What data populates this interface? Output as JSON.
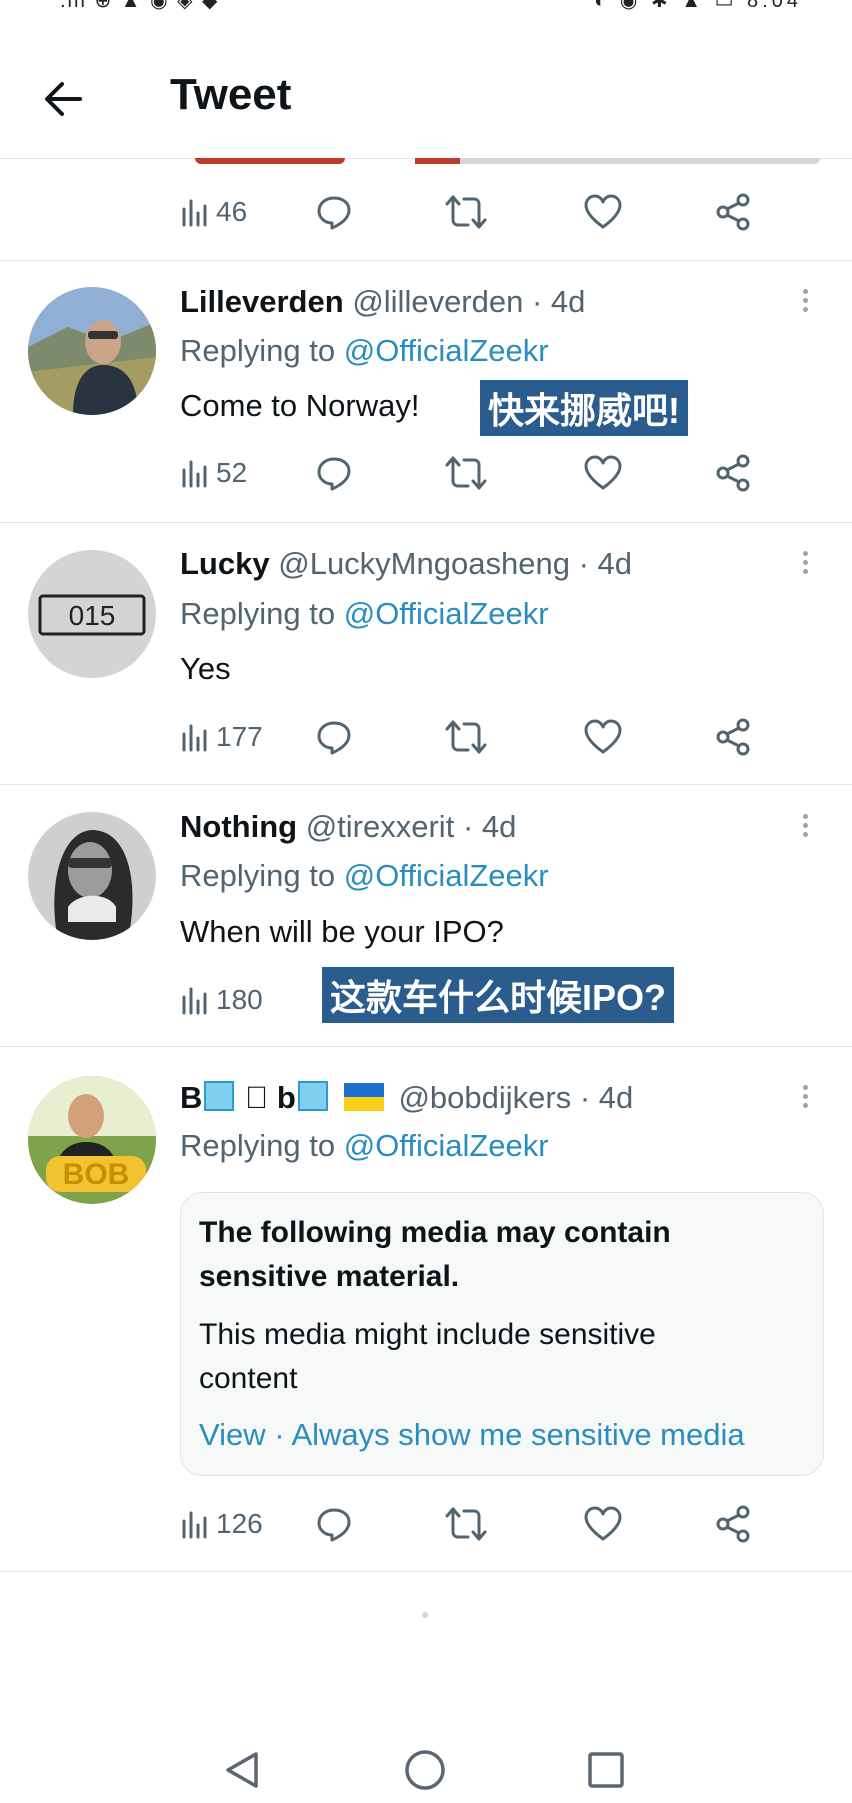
{
  "status_bar": {
    "left_text": ".ill ⊕ ▲ ◉ ◈ ◆",
    "right_text": "◐ ◉ ✱ ▲ ▭ 8:04"
  },
  "header": {
    "title": "Tweet"
  },
  "colors": {
    "accent_link": "#2a8dbf",
    "muted_text": "#536471",
    "cn_tag_bg": "#2b5c8e"
  },
  "top_actions": {
    "views": "46"
  },
  "tweets": [
    {
      "name": "Lilleverden",
      "handle": "@lilleverden",
      "time": "· 4d",
      "replying_prefix": "Replying to ",
      "replying_to": "@OfficialZeekr",
      "text": "Come to Norway!",
      "overlay": "快来挪威吧!",
      "views": "52"
    },
    {
      "name": "Lucky",
      "handle": "@LuckyMngoasheng",
      "time": "· 4d",
      "replying_prefix": "Replying to ",
      "replying_to": "@OfficialZeekr",
      "text": "Yes",
      "avatar_label": "015",
      "views": "177"
    },
    {
      "name": "Nothing",
      "handle": "@tirexxerit",
      "time": "· 4d",
      "replying_prefix": "Replying to ",
      "replying_to": "@OfficialZeekr",
      "text": "When will be your IPO?",
      "overlay": "这款车什么时候IPO?",
      "views": "180"
    },
    {
      "name_b1": "B",
      "name_b2": "b",
      "handle": "@bobdijkers",
      "time": "· 4d",
      "replying_prefix": "Replying to ",
      "replying_to": "@OfficialZeekr",
      "avatar_label": "BOB",
      "sensitive_title": "The following media may contain sensitive material.",
      "sensitive_body": "This media might include sensitive content",
      "sensitive_view": "View",
      "sensitive_sep": " · ",
      "sensitive_always": "Always show me sensitive media",
      "views": "126"
    }
  ]
}
